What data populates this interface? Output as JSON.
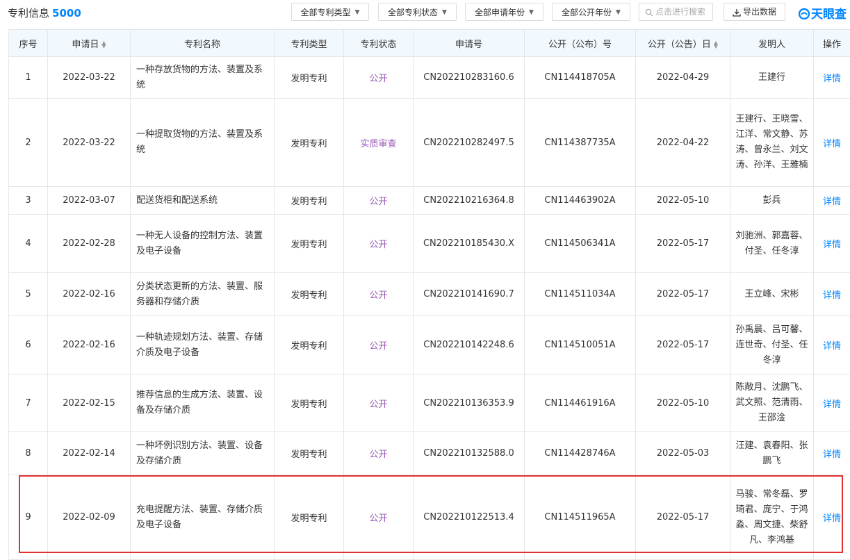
{
  "header": {
    "title": "专利信息",
    "count": "5000",
    "filters": [
      "全部专利类型",
      "全部专利状态",
      "全部申请年份",
      "全部公开年份"
    ],
    "search_placeholder": "点击进行搜索",
    "export_label": "导出数据",
    "logo_text": "天眼查"
  },
  "columns": [
    "序号",
    "申请日",
    "专利名称",
    "专利类型",
    "专利状态",
    "申请号",
    "公开（公布）号",
    "公开（公告）日",
    "发明人",
    "操作"
  ],
  "colors": {
    "accent": "#0084ff",
    "status": "#9b59b6",
    "highlight": "#e03131",
    "header_bg": "#f2f9fe"
  },
  "rows": [
    {
      "no": "1",
      "date": "2022-03-22",
      "name": "一种存放货物的方法、装置及系统",
      "type": "发明专利",
      "status": "公开",
      "app": "CN202210283160.6",
      "pub": "CN114418705A",
      "pubdate": "2022-04-29",
      "inventors": "王建行",
      "op": "详情"
    },
    {
      "no": "2",
      "date": "2022-03-22",
      "name": "一种提取货物的方法、装置及系统",
      "type": "发明专利",
      "status": "实质审查",
      "app": "CN202210282497.5",
      "pub": "CN114387735A",
      "pubdate": "2022-04-22",
      "inventors": "王建行、王晓雪、江洋、常文静、苏涛、曾永兰、刘文涛、孙洋、王雅楠",
      "op": "详情"
    },
    {
      "no": "3",
      "date": "2022-03-07",
      "name": "配送货柜和配送系统",
      "type": "发明专利",
      "status": "公开",
      "app": "CN202210216364.8",
      "pub": "CN114463902A",
      "pubdate": "2022-05-10",
      "inventors": "彭兵",
      "op": "详情"
    },
    {
      "no": "4",
      "date": "2022-02-28",
      "name": "一种无人设备的控制方法、装置及电子设备",
      "type": "发明专利",
      "status": "公开",
      "app": "CN202210185430.X",
      "pub": "CN114506341A",
      "pubdate": "2022-05-17",
      "inventors": "刘驰洲、郭嘉蓉、付圣、任冬淳",
      "op": "详情"
    },
    {
      "no": "5",
      "date": "2022-02-16",
      "name": "分类状态更新的方法、装置、服务器和存储介质",
      "type": "发明专利",
      "status": "公开",
      "app": "CN202210141690.7",
      "pub": "CN114511034A",
      "pubdate": "2022-05-17",
      "inventors": "王立峰、宋彬",
      "op": "详情"
    },
    {
      "no": "6",
      "date": "2022-02-16",
      "name": "一种轨迹规划方法、装置、存储介质及电子设备",
      "type": "发明专利",
      "status": "公开",
      "app": "CN202210142248.6",
      "pub": "CN114510051A",
      "pubdate": "2022-05-17",
      "inventors": "孙禹晨、吕可馨、连世奇、付圣、任冬淳",
      "op": "详情"
    },
    {
      "no": "7",
      "date": "2022-02-15",
      "name": "推荐信息的生成方法、装置、设备及存储介质",
      "type": "发明专利",
      "status": "公开",
      "app": "CN202210136353.9",
      "pub": "CN114461916A",
      "pubdate": "2022-05-10",
      "inventors": "陈敞月、沈鹏飞、武文照、范清雨、王邵淦",
      "op": "详情"
    },
    {
      "no": "8",
      "date": "2022-02-14",
      "name": "一种坏例识别方法、装置、设备及存储介质",
      "type": "发明专利",
      "status": "公开",
      "app": "CN202210132588.0",
      "pub": "CN114428746A",
      "pubdate": "2022-05-03",
      "inventors": "汪建、袁春阳、张鹏飞",
      "op": "详情"
    },
    {
      "no": "9",
      "date": "2022-02-09",
      "name": "充电提醒方法、装置、存储介质及电子设备",
      "type": "发明专利",
      "status": "公开",
      "app": "CN202210122513.4",
      "pub": "CN114511965A",
      "pubdate": "2022-05-17",
      "inventors": "马骏、常冬磊、罗琦君、庞宁、于鸿淼、周文捷、柴舒凡、李鸿基",
      "op": "详情"
    }
  ]
}
